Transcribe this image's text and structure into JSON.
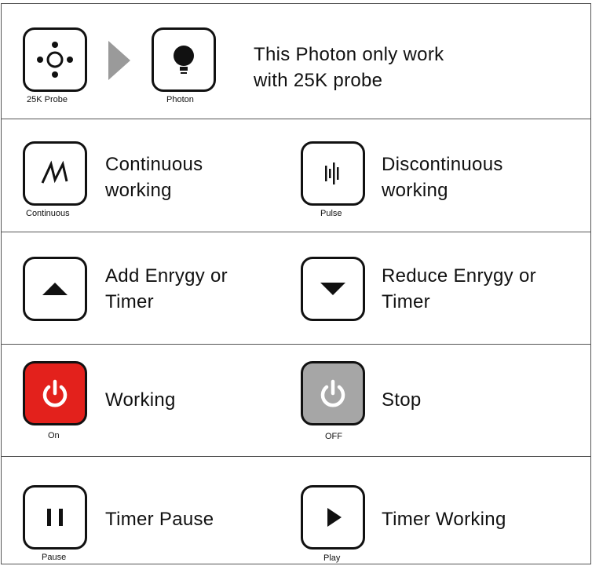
{
  "colors": {
    "on": "#e3211c",
    "off": "#a6a6a6",
    "border": "#111111",
    "arrow": "#9a9a9a"
  },
  "rows": [
    {
      "items": [
        {
          "icon": "crosshair-dots-icon",
          "caption": "25K Probe"
        },
        {
          "icon": "bulb-icon",
          "caption": "Photon"
        }
      ],
      "description_lines": [
        "This Photon only work",
        "with 25K probe"
      ]
    },
    {
      "items": [
        {
          "icon": "continuous-wave-icon",
          "caption": "Continuous",
          "text_lines": [
            "Continuous",
            "working"
          ]
        },
        {
          "icon": "pulse-icon",
          "caption": "Pulse",
          "text_lines": [
            "Discontinuous",
            "working"
          ]
        }
      ]
    },
    {
      "items": [
        {
          "icon": "triangle-up-icon",
          "caption": "",
          "text_lines": [
            "Add Enrygy or",
            "Timer"
          ]
        },
        {
          "icon": "triangle-down-icon",
          "caption": "",
          "text_lines": [
            "Reduce Enrygy or",
            "Timer"
          ]
        }
      ]
    },
    {
      "items": [
        {
          "icon": "power-icon",
          "caption": "On",
          "text_lines": [
            "Working"
          ]
        },
        {
          "icon": "power-icon",
          "caption": "OFF",
          "text_lines": [
            "Stop"
          ]
        }
      ]
    },
    {
      "items": [
        {
          "icon": "pause-icon",
          "caption": "Pause",
          "text_lines": [
            "Timer Pause"
          ]
        },
        {
          "icon": "play-icon",
          "caption": "Play",
          "text_lines": [
            "Timer Working"
          ]
        }
      ]
    }
  ]
}
